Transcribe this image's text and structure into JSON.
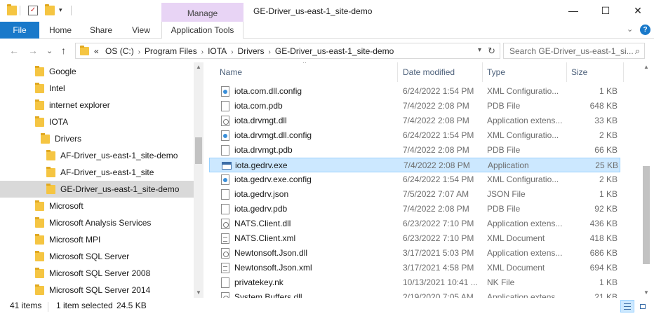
{
  "window": {
    "title": "GE-Driver_us-east-1_site-demo",
    "context_tab": "Manage",
    "minimize": "—",
    "maximize": "☐",
    "close": "✕"
  },
  "ribbon": {
    "tabs": [
      "File",
      "Home",
      "Share",
      "View",
      "Application Tools"
    ],
    "expand_glyph": "⌄",
    "help_glyph": "?"
  },
  "nav": {
    "back_glyph": "←",
    "forward_glyph": "→",
    "recent_glyph": "⌄",
    "up_glyph": "↑",
    "overflow": "«",
    "path": [
      "OS (C:)",
      "Program Files",
      "IOTA",
      "Drivers",
      "GE-Driver_us-east-1_site-demo"
    ],
    "search_placeholder": "Search GE-Driver_us-east-1_si..."
  },
  "tree": [
    {
      "label": "Google",
      "indent": 0,
      "selected": false
    },
    {
      "label": "Intel",
      "indent": 0,
      "selected": false
    },
    {
      "label": "internet explorer",
      "indent": 0,
      "selected": false
    },
    {
      "label": "IOTA",
      "indent": 0,
      "selected": false
    },
    {
      "label": "Drivers",
      "indent": 1,
      "selected": false
    },
    {
      "label": "AF-Driver_us-east-1_site-demo",
      "indent": 2,
      "selected": false
    },
    {
      "label": "AF-Driver_us-east-1_site",
      "indent": 2,
      "selected": false
    },
    {
      "label": "GE-Driver_us-east-1_site-demo",
      "indent": 2,
      "selected": true
    },
    {
      "label": "Microsoft",
      "indent": 0,
      "selected": false
    },
    {
      "label": "Microsoft Analysis Services",
      "indent": 0,
      "selected": false
    },
    {
      "label": "Microsoft MPI",
      "indent": 0,
      "selected": false
    },
    {
      "label": "Microsoft SQL Server",
      "indent": 0,
      "selected": false
    },
    {
      "label": "Microsoft SQL Server 2008",
      "indent": 0,
      "selected": false
    },
    {
      "label": "Microsoft SQL Server 2014",
      "indent": 0,
      "selected": false
    }
  ],
  "columns": {
    "name": "Name",
    "date": "Date modified",
    "type": "Type",
    "size": "Size"
  },
  "files": [
    {
      "name": "iota.com.dll.config",
      "date": "6/24/2022 1:54 PM",
      "type": "XML Configuratio...",
      "size": "1 KB",
      "icon": "cfg",
      "selected": false
    },
    {
      "name": "iota.com.pdb",
      "date": "7/4/2022 2:08 PM",
      "type": "PDB File",
      "size": "648 KB",
      "icon": "file",
      "selected": false
    },
    {
      "name": "iota.drvmgt.dll",
      "date": "7/4/2022 2:08 PM",
      "type": "Application extens...",
      "size": "33 KB",
      "icon": "dll",
      "selected": false
    },
    {
      "name": "iota.drvmgt.dll.config",
      "date": "6/24/2022 1:54 PM",
      "type": "XML Configuratio...",
      "size": "2 KB",
      "icon": "cfg",
      "selected": false
    },
    {
      "name": "iota.drvmgt.pdb",
      "date": "7/4/2022 2:08 PM",
      "type": "PDB File",
      "size": "66 KB",
      "icon": "file",
      "selected": false
    },
    {
      "name": "iota.gedrv.exe",
      "date": "7/4/2022 2:08 PM",
      "type": "Application",
      "size": "25 KB",
      "icon": "exe",
      "selected": true
    },
    {
      "name": "iota.gedrv.exe.config",
      "date": "6/24/2022 1:54 PM",
      "type": "XML Configuratio...",
      "size": "2 KB",
      "icon": "cfg",
      "selected": false
    },
    {
      "name": "iota.gedrv.json",
      "date": "7/5/2022 7:07 AM",
      "type": "JSON File",
      "size": "1 KB",
      "icon": "file",
      "selected": false
    },
    {
      "name": "iota.gedrv.pdb",
      "date": "7/4/2022 2:08 PM",
      "type": "PDB File",
      "size": "92 KB",
      "icon": "file",
      "selected": false
    },
    {
      "name": "NATS.Client.dll",
      "date": "6/23/2022 7:10 PM",
      "type": "Application extens...",
      "size": "436 KB",
      "icon": "dll",
      "selected": false
    },
    {
      "name": "NATS.Client.xml",
      "date": "6/23/2022 7:10 PM",
      "type": "XML Document",
      "size": "418 KB",
      "icon": "xml",
      "selected": false
    },
    {
      "name": "Newtonsoft.Json.dll",
      "date": "3/17/2021 5:03 PM",
      "type": "Application extens...",
      "size": "686 KB",
      "icon": "dll",
      "selected": false
    },
    {
      "name": "Newtonsoft.Json.xml",
      "date": "3/17/2021 4:58 PM",
      "type": "XML Document",
      "size": "694 KB",
      "icon": "xml",
      "selected": false
    },
    {
      "name": "privatekey.nk",
      "date": "10/13/2021 10:41 ...",
      "type": "NK File",
      "size": "1 KB",
      "icon": "file",
      "selected": false
    },
    {
      "name": "System.Buffers.dll",
      "date": "2/19/2020 7:05 AM",
      "type": "Application extens...",
      "size": "21 KB",
      "icon": "dll",
      "selected": false
    }
  ],
  "status": {
    "item_count": "41 items",
    "selection": "1 item selected",
    "selection_size": "24.5 KB"
  },
  "colors": {
    "file_tab": "#1979ca",
    "manage_tab": "#e8d4f5",
    "selection_fill": "#cce8ff",
    "selection_border": "#99d1ff",
    "tree_selection": "#d9d9d9",
    "folder": "#f5c542"
  }
}
